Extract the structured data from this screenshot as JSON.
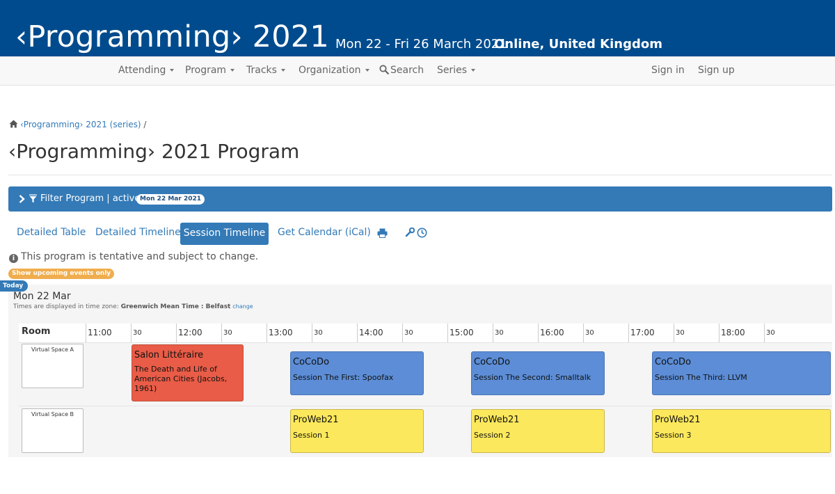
{
  "header": {
    "title": "‹Programming› 2021",
    "dates": "Mon 22 - Fri 26 March 2021",
    "location": "Online, United Kingdom"
  },
  "nav": {
    "attending": "Attending",
    "program": "Program",
    "tracks": "Tracks",
    "organization": "Organization",
    "search": "Search",
    "series": "Series",
    "sign_in": "Sign in",
    "sign_up": "Sign up"
  },
  "breadcrumb": {
    "link": "‹Programming› 2021 (series)",
    "separator": "/"
  },
  "page_title": "‹Programming› 2021 Program",
  "filter": {
    "label": "Filter Program | active:",
    "badge": "Mon 22 Mar 2021"
  },
  "tabs": {
    "detailed_table": "Detailed Table",
    "detailed_timeline": "Detailed Timeline",
    "session_timeline": "Session Timeline",
    "calendar": "Get Calendar (iCal)"
  },
  "notice": "This program is tentative and subject to change.",
  "upcoming_button": "Show upcoming events only",
  "today_label": "Today",
  "schedule": {
    "day": "Mon 22 Mar",
    "tz_prefix": "Times are displayed in time zone:",
    "tz_name": "Greenwich Mean Time : Belfast",
    "tz_change": "change",
    "room_header": "Room",
    "ticks": [
      "11:00",
      "30",
      "12:00",
      "30",
      "13:00",
      "30",
      "14:00",
      "30",
      "15:00",
      "30",
      "16:00",
      "30",
      "17:00",
      "30",
      "18:00",
      "30"
    ],
    "rooms": [
      {
        "name": "Virtual Space A",
        "events": [
          {
            "title": "Salon Littéraire",
            "subtitle": "The Death and Life of American Cities (Jacobs, 1961)",
            "color": "#e95c47"
          },
          {
            "title": "CoCoDo",
            "subtitle": "Session The First: Spoofax",
            "color": "#5c8dd6"
          },
          {
            "title": "CoCoDo",
            "subtitle": "Session The Second: Smalltalk",
            "color": "#5c8dd6"
          },
          {
            "title": "CoCoDo",
            "subtitle": "Session The Third: LLVM",
            "color": "#5c8dd6"
          }
        ]
      },
      {
        "name": "Virtual Space B",
        "events": [
          {
            "title": "ProWeb21",
            "subtitle": "Session 1",
            "color": "#fce85c"
          },
          {
            "title": "ProWeb21",
            "subtitle": "Session 2",
            "color": "#fce85c"
          },
          {
            "title": "ProWeb21",
            "subtitle": "Session 3",
            "color": "#fce85c"
          }
        ]
      }
    ]
  },
  "colors": {
    "brand": "#004b8d",
    "accent": "#337ab7",
    "warning": "#f0ad4e"
  }
}
